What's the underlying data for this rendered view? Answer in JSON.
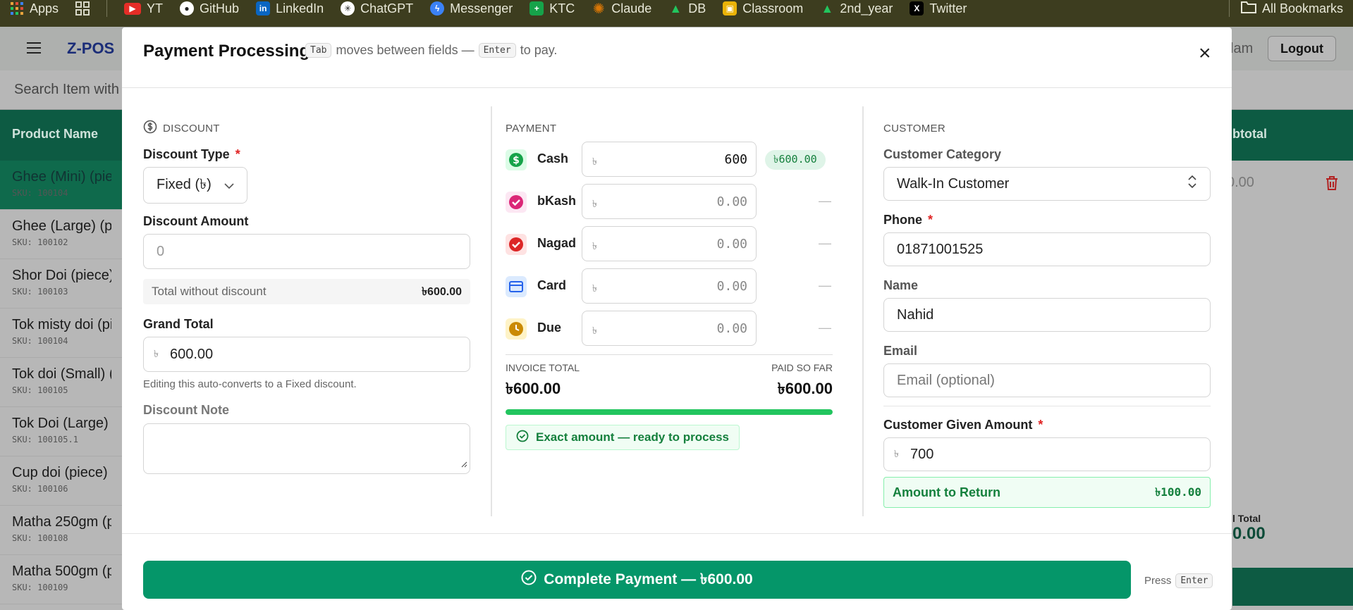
{
  "bookmarks": {
    "items": [
      {
        "label": "Apps",
        "icon": "apps-grid-icon",
        "color": "#e8a33b"
      },
      {
        "label": "",
        "icon": "grid-icon",
        "color": "#cfcfc0"
      },
      {
        "label": "YT",
        "icon": "youtube-icon",
        "color": "#e52d27"
      },
      {
        "label": "GitHub",
        "icon": "github-icon",
        "color": "#ffffff"
      },
      {
        "label": "LinkedIn",
        "icon": "linkedin-icon",
        "color": "#0a66c2"
      },
      {
        "label": "ChatGPT",
        "icon": "chatgpt-icon",
        "color": "#ffffff"
      },
      {
        "label": "Messenger",
        "icon": "messenger-icon",
        "color": "#3b82f6"
      },
      {
        "label": "KTC",
        "icon": "sheets-icon",
        "color": "#16a34a"
      },
      {
        "label": "Claude",
        "icon": "claude-icon",
        "color": "#d97706"
      },
      {
        "label": "DB",
        "icon": "drive-icon",
        "color": "#22c55e"
      },
      {
        "label": "Classroom",
        "icon": "classroom-icon",
        "color": "#eab308"
      },
      {
        "label": "2nd_year",
        "icon": "drive-icon",
        "color": "#22c55e"
      },
      {
        "label": "Twitter",
        "icon": "x-icon",
        "color": "#000000"
      }
    ],
    "all_bookmarks": "All Bookmarks"
  },
  "app": {
    "brand": "Z-POS",
    "user_partial": "lam",
    "logout": "Logout",
    "search_placeholder": "Search Item with",
    "col_product": "Product Name",
    "col_subtotal": "btotal",
    "subtotal_value": "0.00",
    "total_label": "l Total",
    "total_value": "0.00",
    "products": [
      {
        "name": "Ghee (Mini) (pie",
        "sku": "SKU: 100104",
        "selected": true
      },
      {
        "name": "Ghee (Large) (pi",
        "sku": "SKU: 100102",
        "selected": false
      },
      {
        "name": "Shor Doi (piece)",
        "sku": "SKU: 100103",
        "selected": false
      },
      {
        "name": "Tok misty doi (pi",
        "sku": "SKU: 100104",
        "selected": false
      },
      {
        "name": "Tok doi (Small) (",
        "sku": "SKU: 100105",
        "selected": false
      },
      {
        "name": "Tok Doi (Large) (",
        "sku": "SKU: 100105.1",
        "selected": false
      },
      {
        "name": "Cup doi (piece)",
        "sku": "SKU: 100106",
        "selected": false
      },
      {
        "name": "Matha 250gm (p",
        "sku": "SKU: 100108",
        "selected": false
      },
      {
        "name": "Matha 500gm (p",
        "sku": "SKU: 100109",
        "selected": false
      }
    ]
  },
  "modal": {
    "title": "Payment Processing",
    "hint_key1": "Tab",
    "hint_text1": "moves between fields —",
    "hint_key2": "Enter",
    "hint_text2": "to pay.",
    "discount": {
      "section": "DISCOUNT",
      "type_label": "Discount Type",
      "type_value": "Fixed (৳)",
      "amount_label": "Discount Amount",
      "amount_placeholder": "0",
      "total_wo_label": "Total without discount",
      "total_wo_value": "৳600.00",
      "grand_label": "Grand Total",
      "grand_currency": "৳",
      "grand_value": "600.00",
      "grand_help": "Editing this auto-converts to a Fixed discount.",
      "note_label": "Discount Note"
    },
    "payment": {
      "section": "PAYMENT",
      "methods": [
        {
          "name": "Cash",
          "value": "600",
          "badge": "৳600.00",
          "icon": "cash-icon",
          "icon_bg": "#16a34a"
        },
        {
          "name": "bKash",
          "value": "0.00",
          "badge": "—",
          "icon": "bkash-icon",
          "icon_bg": "#db2777"
        },
        {
          "name": "Nagad",
          "value": "0.00",
          "badge": "—",
          "icon": "nagad-icon",
          "icon_bg": "#dc2626"
        },
        {
          "name": "Card",
          "value": "0.00",
          "badge": "—",
          "icon": "card-icon",
          "icon_bg": "#2563eb"
        },
        {
          "name": "Due",
          "value": "0.00",
          "badge": "—",
          "icon": "clock-icon",
          "icon_bg": "#ca8a04"
        }
      ],
      "currency": "৳",
      "invoice_label": "INVOICE TOTAL",
      "invoice_value": "৳600.00",
      "paid_label": "PAID SO FAR",
      "paid_value": "৳600.00",
      "progress": 1.0,
      "status": "Exact amount — ready to process"
    },
    "customer": {
      "section": "CUSTOMER",
      "category_label": "Customer Category",
      "category_value": "Walk-In Customer",
      "phone_label": "Phone",
      "phone_value": "01871001525",
      "name_label": "Name",
      "name_value": "Nahid",
      "email_label": "Email",
      "email_placeholder": "Email (optional)",
      "given_label": "Customer Given Amount",
      "given_currency": "৳",
      "given_value": "700",
      "return_label": "Amount to Return",
      "return_value": "৳100.00"
    },
    "complete_button": "Complete Payment — ৳600.00",
    "press_label": "Press",
    "press_key": "Enter"
  },
  "colors": {
    "accent": "#059669",
    "header_green": "#0d5b43",
    "required": "#e02424"
  }
}
